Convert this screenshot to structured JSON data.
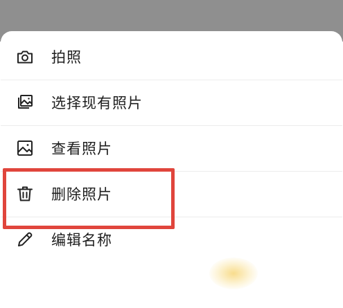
{
  "menu": {
    "items": [
      {
        "label": "拍照",
        "icon": "camera-icon"
      },
      {
        "label": "选择现有照片",
        "icon": "photo-gallery-icon"
      },
      {
        "label": "查看照片",
        "icon": "image-view-icon"
      },
      {
        "label": "删除照片",
        "icon": "trash-icon"
      },
      {
        "label": "编辑名称",
        "icon": "pencil-icon"
      }
    ]
  },
  "colors": {
    "backdrop": "#8f8f8f",
    "highlight": "#e0453c",
    "text": "#1e1e1e",
    "icon": "#222222"
  }
}
